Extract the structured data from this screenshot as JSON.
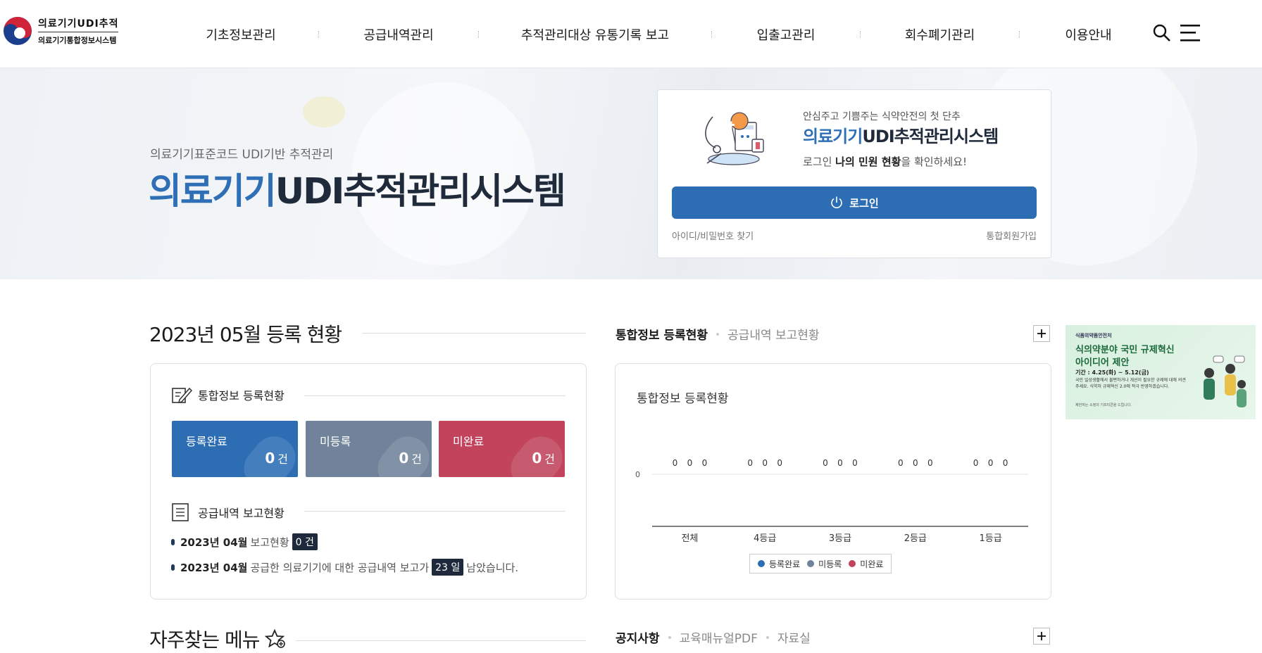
{
  "header": {
    "logo_line1": "의료기기UDI추적",
    "logo_line2": "의료기기통합정보시스템",
    "nav": [
      "기초정보관리",
      "공급내역관리",
      "추적관리대상 유통기록 보고",
      "입출고관리",
      "회수폐기관리",
      "이용안내"
    ]
  },
  "hero": {
    "subtitle": "의료기기표준코드 UDI기반 추적관리",
    "title_blue": "의료기기",
    "title_dark": "UDI추적관리시스템"
  },
  "login": {
    "tagline": "안심주고 기쁨주는 식약안전의 첫 단추",
    "name_blue": "의료기기",
    "name_dark": "UDI추적관리시스템",
    "msg_prefix": "로그인 ",
    "msg_bold": "나의 민원 현황",
    "msg_suffix": "을 확인하세요!",
    "button": "로그인",
    "find": "아이디/비밀번호 찾기",
    "join": "통합회원가입"
  },
  "registration": {
    "title": "2023년 05월 등록 현황",
    "integrated_title": "통합정보 등록현황",
    "stats": [
      {
        "label": "등록완료",
        "count": "0",
        "unit": "건",
        "color": "#2c6db4"
      },
      {
        "label": "미등록",
        "count": "0",
        "unit": "건",
        "color": "#71839a"
      },
      {
        "label": "미완료",
        "count": "0",
        "unit": "건",
        "color": "#c1445c"
      }
    ],
    "supply_title": "공급내역 보고현황",
    "line1": {
      "bold": "2023년 04월",
      "text": "보고현황",
      "badge": "0 건"
    },
    "line2": {
      "bold": "2023년 04월",
      "text": "공급한 의료기기에 대한 공급내역 보고가",
      "badge": "23 일",
      "suffix": "남았습니다."
    }
  },
  "status_tabs": {
    "active": "통합정보 등록현황",
    "inactive": "공급내역 보고현황"
  },
  "chart_data": {
    "type": "bar",
    "title": "통합정보 등록현황",
    "categories": [
      "전체",
      "4등급",
      "3등급",
      "2등급",
      "1등급"
    ],
    "series": [
      {
        "name": "등록완료",
        "values": [
          0,
          0,
          0,
          0,
          0
        ],
        "color": "#2c6db4"
      },
      {
        "name": "미등록",
        "values": [
          0,
          0,
          0,
          0,
          0
        ],
        "color": "#71839a"
      },
      {
        "name": "미완료",
        "values": [
          0,
          0,
          0,
          0,
          0
        ],
        "color": "#c1445c"
      }
    ],
    "y_tick": "0",
    "legend_position": "bottom"
  },
  "banner": {
    "org": "식품의약품안전처",
    "line1": "식의약분야 국민 규제혁신",
    "line2": "아이디어 제안",
    "period": "기간 : 4.25(화) ~ 5.12(금)",
    "desc": "국민 일상생활에서 불편하거나 개선이 필요한 규제에 대해 의견 주세요. 식약처 규제혁신 2.0에 적극 반영하겠습니다.",
    "foot": "제안자는 소정의 기프티콘을 드립니다."
  },
  "bottom": {
    "favorites": "자주찾는 메뉴",
    "tabs": [
      "공지사항",
      "교육매뉴얼PDF",
      "자료실"
    ]
  }
}
